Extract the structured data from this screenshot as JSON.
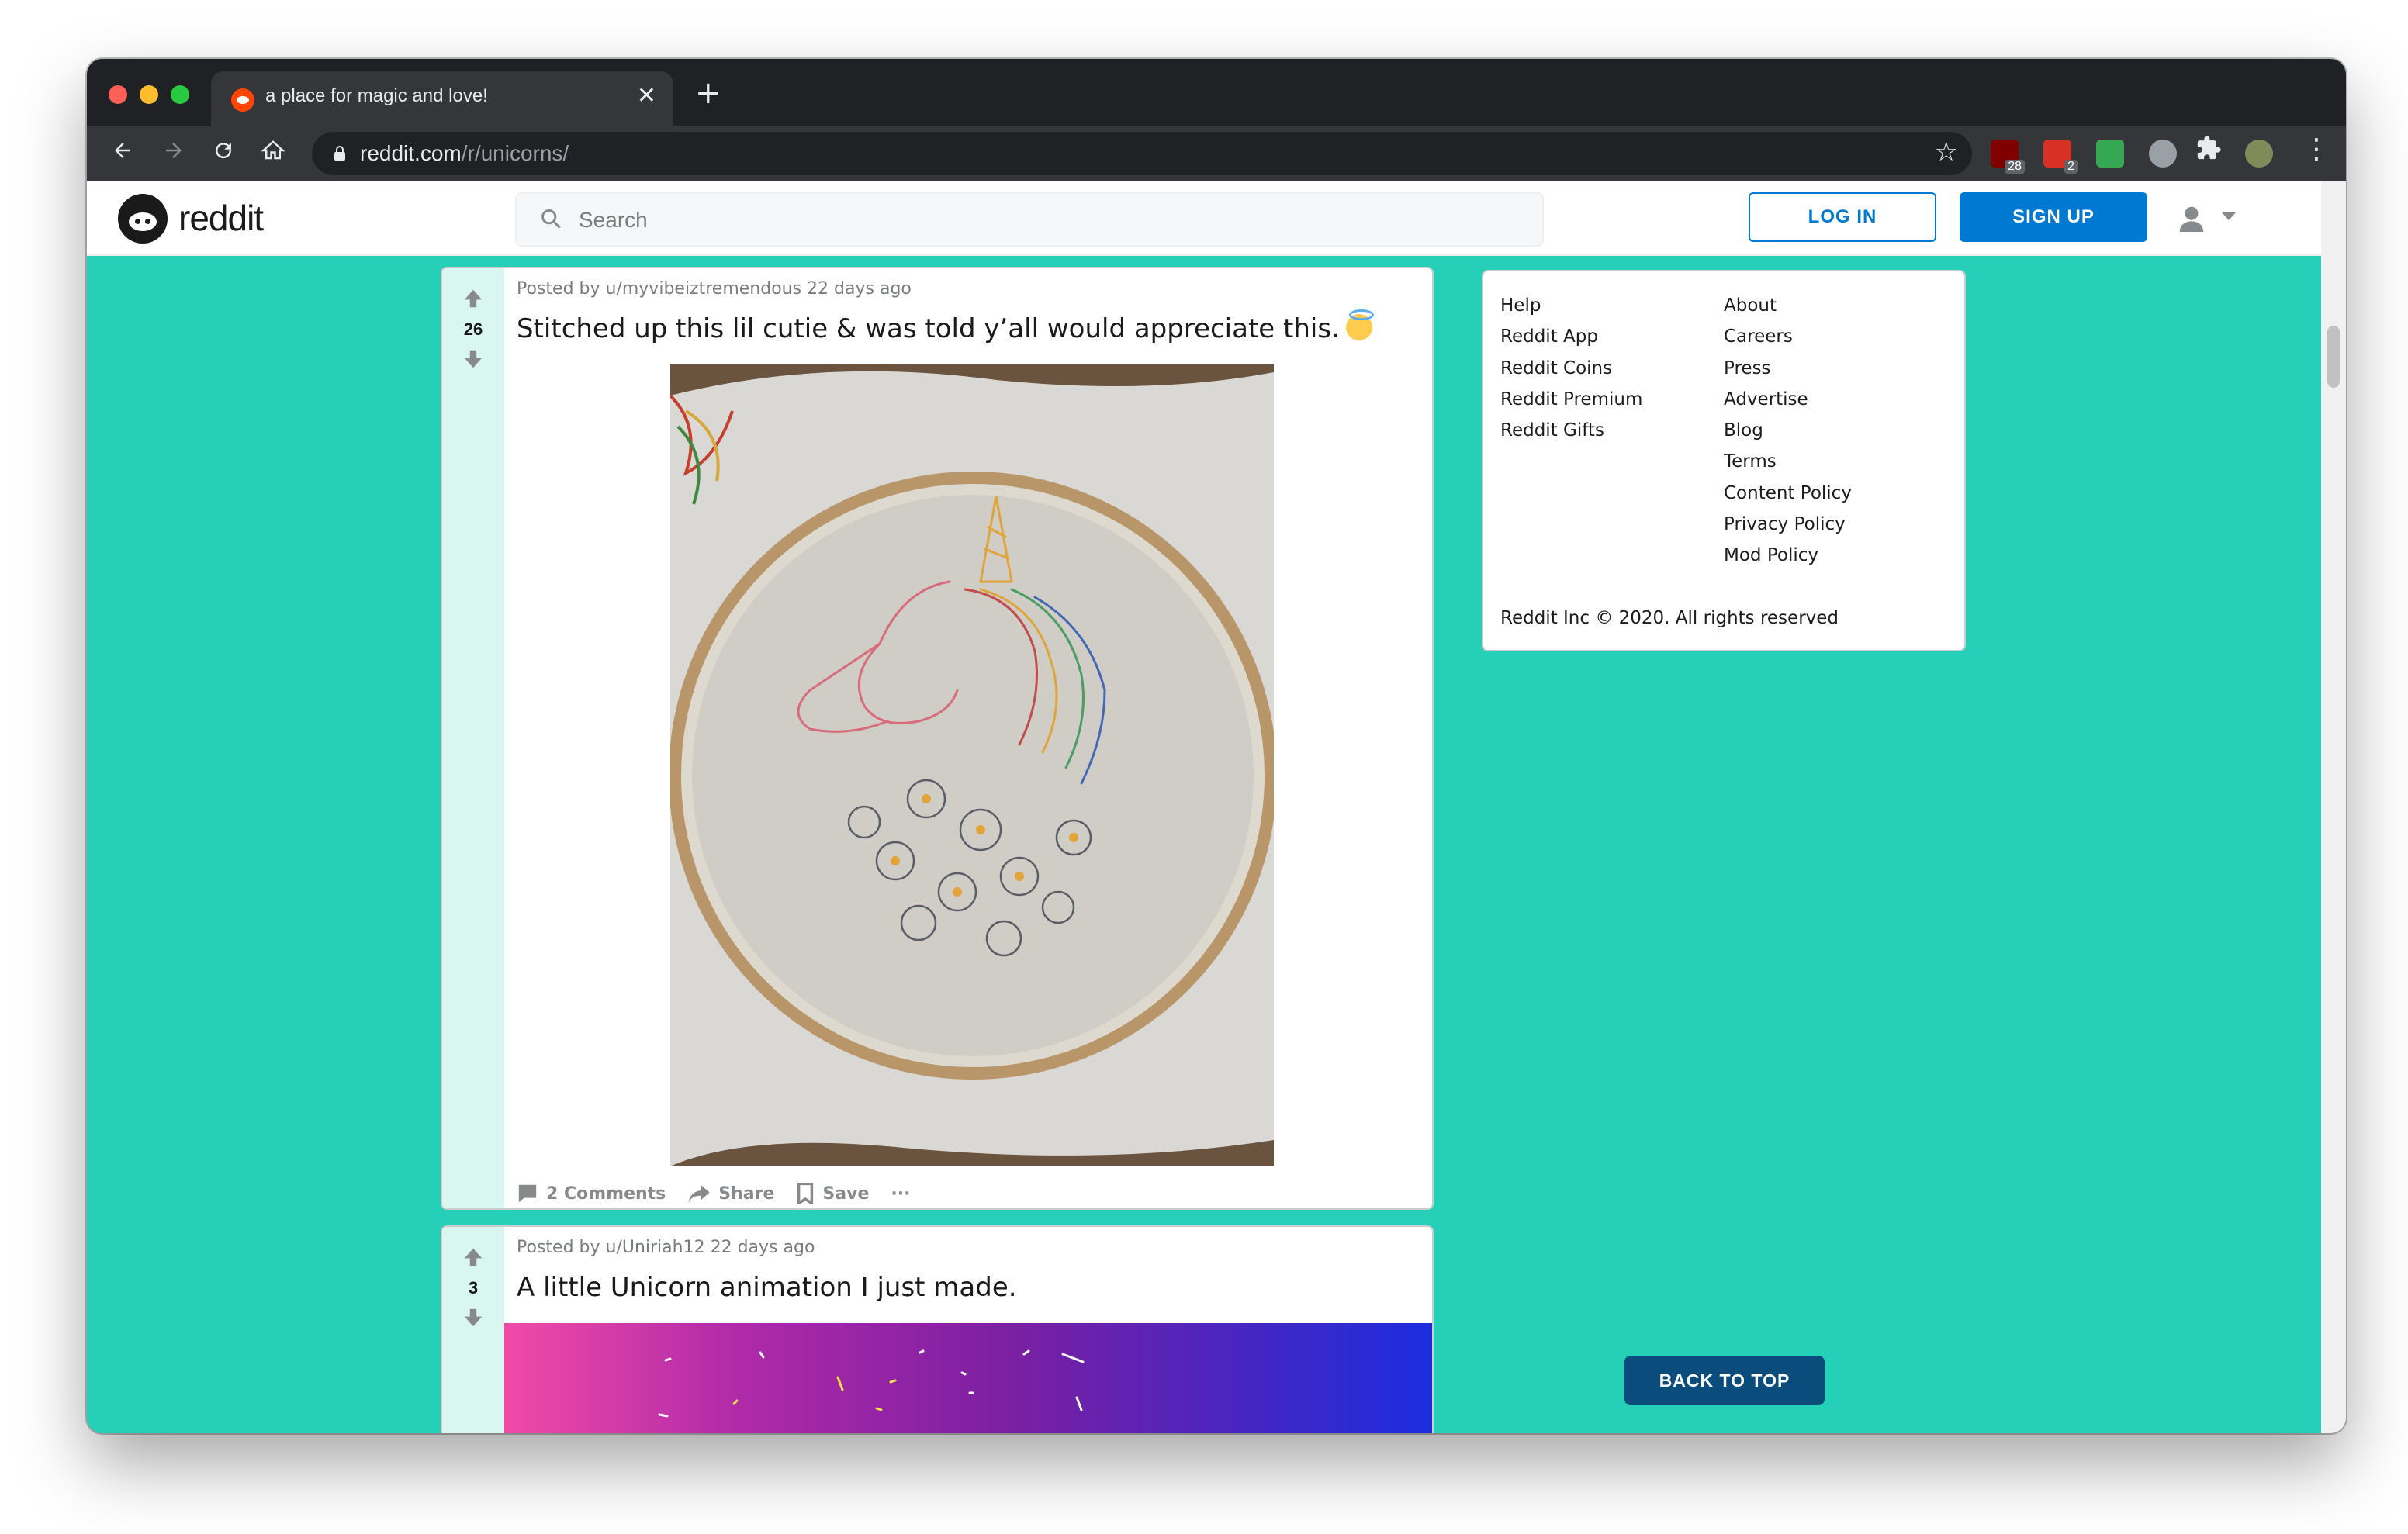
{
  "browser": {
    "tab_title": "a place for magic and love!",
    "tab_close": "✕",
    "new_tab": "+",
    "url_host": "reddit.com",
    "url_path": "/r/unicorns/",
    "extensions": [
      {
        "name": "ublock-icon",
        "badge": "28"
      },
      {
        "name": "todo-icon",
        "badge": "2"
      }
    ],
    "colors": {
      "chrome_dark": "#202124",
      "chrome_toolbar": "#35363a"
    }
  },
  "header": {
    "wordmark": "reddit",
    "search_placeholder": "Search",
    "login_label": "LOG IN",
    "signup_label": "SIGN UP",
    "colors": {
      "brand_blue": "#0079d3",
      "background": "#26d0b8"
    }
  },
  "posts": [
    {
      "meta": "Posted by u/myvibeiztremendous 22 days ago",
      "score": "26",
      "title": "Stitched up this lil cutie & was told y’all would appreciate this.",
      "title_emoji": "smiling-face-with-halo-icon",
      "footer": {
        "comments": "2 Comments",
        "share": "Share",
        "save": "Save",
        "more": "···"
      }
    },
    {
      "meta": "Posted by u/Uniriah12 22 days ago",
      "score": "3",
      "title": "A little Unicorn animation I just made."
    }
  ],
  "sidebar": {
    "left_links": [
      "Help",
      "Reddit App",
      "Reddit Coins",
      "Reddit Premium",
      "Reddit Gifts"
    ],
    "right_links": [
      "About",
      "Careers",
      "Press",
      "Advertise",
      "Blog",
      "Terms",
      "Content Policy",
      "Privacy Policy",
      "Mod Policy"
    ],
    "copyright": "Reddit Inc © 2020. All rights reserved",
    "back_to_top": "BACK TO TOP"
  }
}
